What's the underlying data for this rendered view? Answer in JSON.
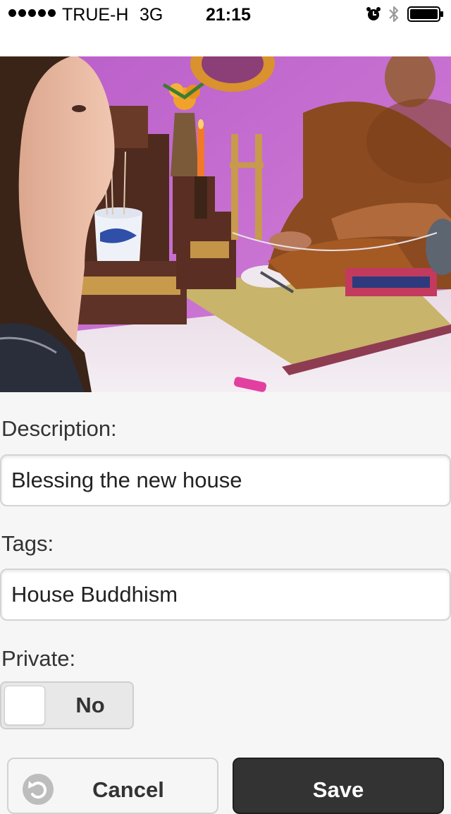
{
  "status_bar": {
    "carrier": "TRUE-H",
    "network": "3G",
    "time": "21:15",
    "signal_bars": 5
  },
  "photo": {
    "icon": "photo-image"
  },
  "form": {
    "description": {
      "label": "Description:",
      "value": "Blessing the new house"
    },
    "tags": {
      "label": "Tags:",
      "value": "House Buddhism"
    },
    "private": {
      "label": "Private:",
      "state": "No"
    }
  },
  "buttons": {
    "cancel_label": "Cancel",
    "save_label": "Save",
    "cancel_icon": "undo-icon"
  },
  "colors": {
    "background": "#f6f6f6",
    "save_button": "#333333",
    "cancel_icon_bg": "#bdbdbd"
  }
}
